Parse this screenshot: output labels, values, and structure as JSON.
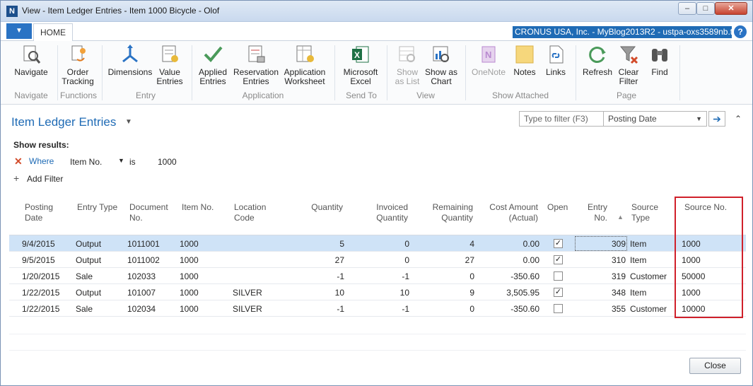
{
  "window": {
    "title": "View - Item Ledger Entries - Item 1000 Bicycle - Olof",
    "app_icon": "nav-logo-icon"
  },
  "ribbon_tabs": [
    "HOME"
  ],
  "company": "CRONUS USA, Inc. - MyBlog2013R2 - ustpa-oxs3589nb.t...",
  "ribbon": {
    "navigate": "Navigate",
    "order_tracking": [
      "Order",
      "Tracking"
    ],
    "dimensions": "Dimensions",
    "value_entries": [
      "Value",
      "Entries"
    ],
    "applied_entries": [
      "Applied",
      "Entries"
    ],
    "reservation_entries": [
      "Reservation",
      "Entries"
    ],
    "application_worksheet": [
      "Application",
      "Worksheet"
    ],
    "microsoft_excel": [
      "Microsoft",
      "Excel"
    ],
    "show_as_list": [
      "Show",
      "as List"
    ],
    "show_as_chart": [
      "Show as",
      "Chart"
    ],
    "onenote": "OneNote",
    "notes": "Notes",
    "links": "Links",
    "refresh": "Refresh",
    "clear_filter": [
      "Clear",
      "Filter"
    ],
    "find": "Find",
    "groups": {
      "navigate": "Navigate",
      "functions": "Functions",
      "entry": "Entry",
      "application": "Application",
      "send_to": "Send To",
      "view": "View",
      "show_attached": "Show Attached",
      "page": "Page"
    }
  },
  "page": {
    "title": "Item Ledger Entries",
    "filter_placeholder": "Type to filter (F3)",
    "filter_field": "Posting Date",
    "show_results": "Show results:",
    "where_label": "Where",
    "where_field": "Item No.",
    "where_op": "is",
    "where_value": "1000",
    "add_filter": "Add Filter"
  },
  "columns": {
    "posting_date": [
      "Posting",
      "Date"
    ],
    "entry_type": [
      "Entry Type"
    ],
    "document_no": [
      "Document",
      "No."
    ],
    "item_no": [
      "Item No."
    ],
    "location_code": [
      "Location",
      "Code"
    ],
    "quantity": [
      "Quantity"
    ],
    "invoiced_quantity": [
      "Invoiced",
      "Quantity"
    ],
    "remaining_quantity": [
      "Remaining",
      "Quantity"
    ],
    "cost_amount": [
      "Cost Amount",
      "(Actual)"
    ],
    "open": [
      "Open"
    ],
    "entry_no": [
      "Entry",
      "No."
    ],
    "source_type": [
      "Source",
      "Type"
    ],
    "source_no": [
      "Source No."
    ]
  },
  "rows": [
    {
      "posting_date": "9/4/2015",
      "entry_type": "Output",
      "document_no": "1011001",
      "item_no": "1000",
      "location_code": "",
      "quantity": "5",
      "invoiced_quantity": "0",
      "remaining_quantity": "4",
      "cost_amount": "0.00",
      "open": true,
      "entry_no": "309",
      "source_type": "Item",
      "source_no": "1000"
    },
    {
      "posting_date": "9/5/2015",
      "entry_type": "Output",
      "document_no": "1011002",
      "item_no": "1000",
      "location_code": "",
      "quantity": "27",
      "invoiced_quantity": "0",
      "remaining_quantity": "27",
      "cost_amount": "0.00",
      "open": true,
      "entry_no": "310",
      "source_type": "Item",
      "source_no": "1000"
    },
    {
      "posting_date": "1/20/2015",
      "entry_type": "Sale",
      "document_no": "102033",
      "item_no": "1000",
      "location_code": "",
      "quantity": "-1",
      "invoiced_quantity": "-1",
      "remaining_quantity": "0",
      "cost_amount": "-350.60",
      "open": false,
      "entry_no": "319",
      "source_type": "Customer",
      "source_no": "50000"
    },
    {
      "posting_date": "1/22/2015",
      "entry_type": "Output",
      "document_no": "101007",
      "item_no": "1000",
      "location_code": "SILVER",
      "quantity": "10",
      "invoiced_quantity": "10",
      "remaining_quantity": "9",
      "cost_amount": "3,505.95",
      "open": true,
      "entry_no": "348",
      "source_type": "Item",
      "source_no": "1000"
    },
    {
      "posting_date": "1/22/2015",
      "entry_type": "Sale",
      "document_no": "102034",
      "item_no": "1000",
      "location_code": "SILVER",
      "quantity": "-1",
      "invoiced_quantity": "-1",
      "remaining_quantity": "0",
      "cost_amount": "-350.60",
      "open": false,
      "entry_no": "355",
      "source_type": "Customer",
      "source_no": "10000"
    }
  ],
  "footer": {
    "close_label": "Close"
  },
  "colors": {
    "accent": "#1f6bb5",
    "selected_row": "#cfe3f7",
    "highlight": "#d0202a"
  }
}
